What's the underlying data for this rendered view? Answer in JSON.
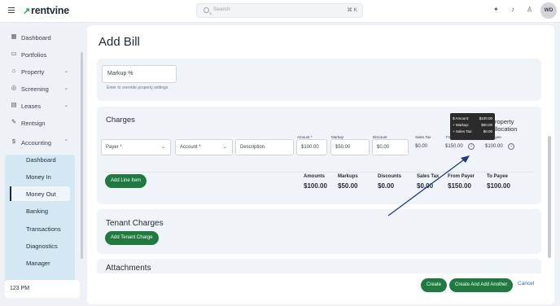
{
  "header": {
    "brand": "rentvine",
    "search_placeholder": "Search",
    "search_shortcut": "⌘ K",
    "avatar_initials": "WD"
  },
  "sidebar": {
    "items": [
      {
        "label": "Dashboard",
        "icon": "dashboard-icon"
      },
      {
        "label": "Portfolios",
        "icon": "folder-icon"
      },
      {
        "label": "Property",
        "icon": "building-icon",
        "expandable": true
      },
      {
        "label": "Screening",
        "icon": "screening-icon",
        "expandable": true
      },
      {
        "label": "Leases",
        "icon": "briefcase-icon",
        "expandable": true
      },
      {
        "label": "Rentsign",
        "icon": "pen-icon"
      },
      {
        "label": "Accounting",
        "icon": "dollar-icon",
        "expanded": true
      }
    ],
    "accounting_subitems": [
      {
        "label": "Dashboard"
      },
      {
        "label": "Money In"
      },
      {
        "label": "Money Out",
        "active": true
      },
      {
        "label": "Banking"
      },
      {
        "label": "Transactions"
      },
      {
        "label": "Diagnostics"
      },
      {
        "label": "Manager"
      }
    ],
    "time": "123 PM"
  },
  "page": {
    "title": "Add Bill",
    "markup": {
      "placeholder": "Markup %",
      "hint": "Enter to override property settings"
    },
    "charges": {
      "title": "Charges",
      "allocation_label": "Property Allocation",
      "payer_label": "Payer *",
      "account_label": "Account *",
      "description_placeholder": "Description",
      "amount_label": "Amount *",
      "amount_value": "$100.00",
      "markup_label": "Markup",
      "markup_value": "$50.00",
      "discount_label": "Discount",
      "discount_value": "$0.00",
      "sales_tax_label": "Sales Tax",
      "sales_tax_value": "$0.00",
      "from_payer_label": "From Payer",
      "from_payer_value": "$150.00",
      "to_payee_label": "To Payee",
      "to_payee_value": "$100.00",
      "add_line_item": "Add Line Item",
      "tooltip": [
        {
          "label": "$ Amount:",
          "value": "$100.00"
        },
        {
          "label": "+ Markup:",
          "value": "$50.00"
        },
        {
          "label": "+ Sales Tax:",
          "value": "$0.00"
        }
      ],
      "totals": [
        {
          "label": "Amounts",
          "value": "$100.00"
        },
        {
          "label": "Markups",
          "value": "$50.00"
        },
        {
          "label": "Discounts",
          "value": "$0.00"
        },
        {
          "label": "Sales Tax",
          "value": "$0.00"
        },
        {
          "label": "From Payer",
          "value": "$150.00"
        },
        {
          "label": "To Payee",
          "value": "$100.00"
        }
      ]
    },
    "tenant_charges": {
      "title": "Tenant Charges",
      "add_button": "Add Tenant Charge"
    },
    "attachments_title": "Attachments",
    "footer": {
      "create": "Create",
      "create_another": "Create And Add Another",
      "cancel": "Cancel"
    }
  },
  "colors": {
    "brand_green": "#1f7a3f",
    "sidebar_active_bg": "#d3e8f3",
    "link_blue": "#2563eb",
    "annotation_arrow": "#1e3a8a"
  }
}
